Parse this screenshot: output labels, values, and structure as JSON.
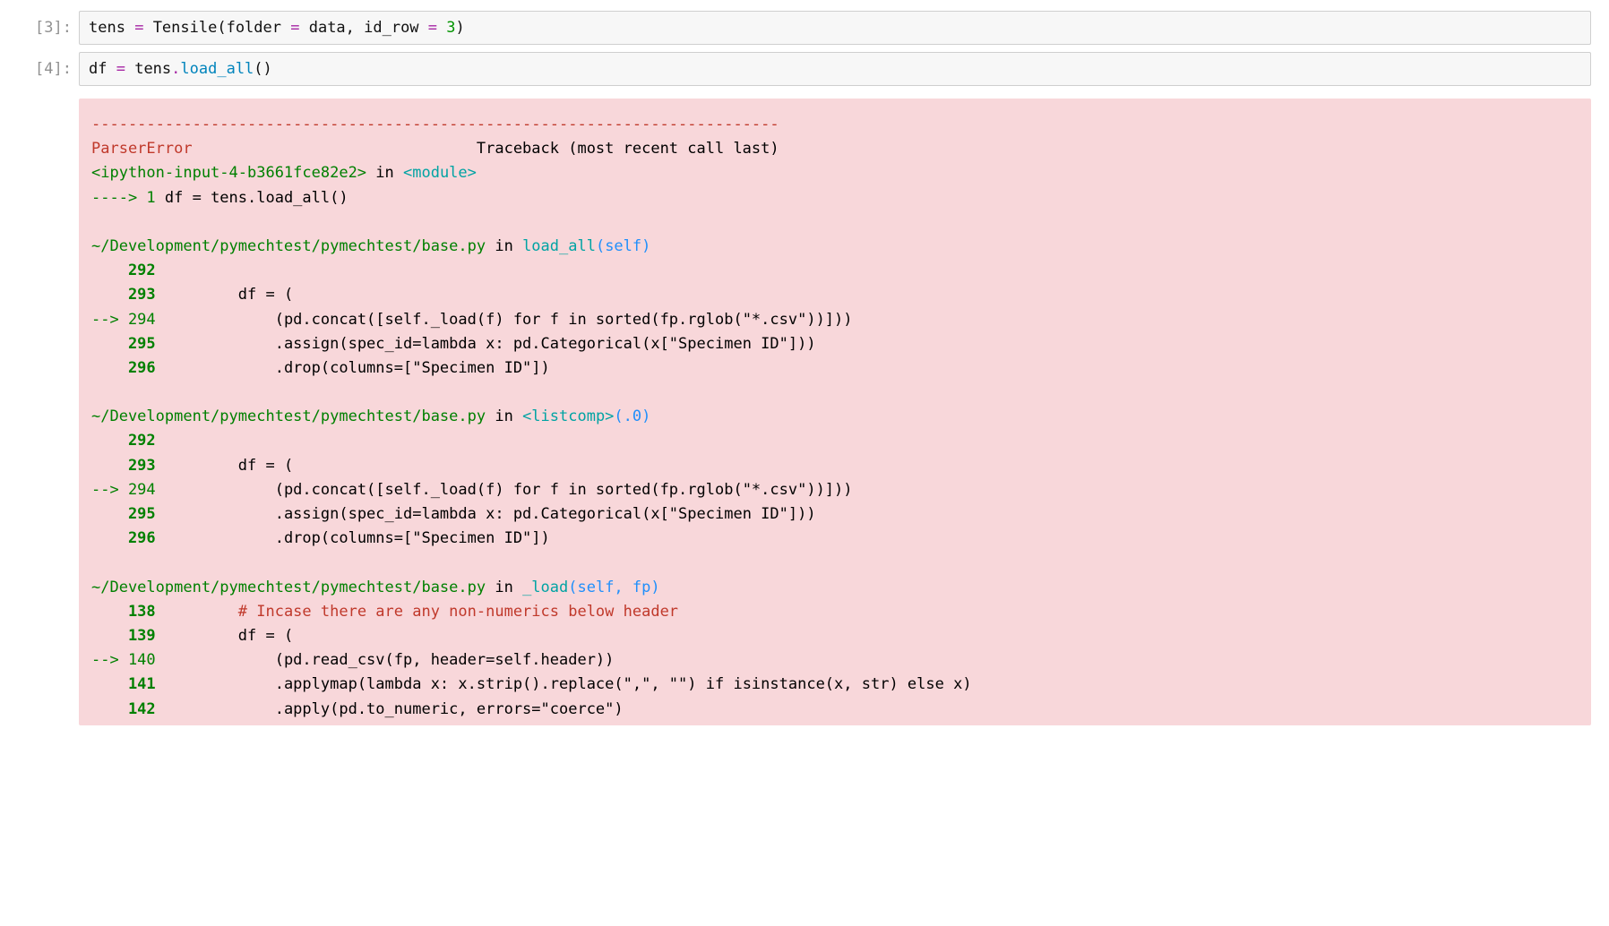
{
  "cells": {
    "c3": {
      "prompt": "[3]:",
      "code": {
        "lhs": "tens ",
        "eq": "=",
        "sp1": " ",
        "call": "Tensile",
        "args": "(folder ",
        "eq2": "=",
        "sp2": " data, id_row ",
        "eq3": "=",
        "sp3": " ",
        "num": "3",
        "close": ")"
      }
    },
    "c4": {
      "prompt": "[4]:",
      "code": {
        "lhs": "df ",
        "eq": "=",
        "sp1": " tens",
        "dot": ".",
        "fn": "load_all",
        "par": "()"
      }
    }
  },
  "traceback": {
    "dashline": "---------------------------------------------------------------------------",
    "error_name": "ParserError",
    "error_header_spacer": "                               ",
    "tb_label": "Traceback (most recent call last)",
    "frame1_loc_pre": "<ipython-input-4-b3661fce82e2>",
    "frame1_in": " in ",
    "frame1_mod": "<module>",
    "frame1_arrow": "----> 1",
    "frame1_line": " df = tens.load_all()",
    "frame2_path": "~/Development/pymechtest/pymechtest/base.py",
    "frame2_in": " in ",
    "frame2_func": "load_all",
    "frame2_args": "(self)",
    "ln292": "    292",
    "ln293_pre": "    293",
    "ln293_code": "         df = (",
    "ln294_arrow": "--> 294",
    "ln294_code": "             (pd.concat([self._load(f) for f in sorted(fp.rglob(\"*.csv\"))]))",
    "ln295_pre": "    295",
    "ln295_code": "             .assign(spec_id=lambda x: pd.Categorical(x[\"Specimen ID\"]))",
    "ln296_pre": "    296",
    "ln296_code": "             .drop(columns=[\"Specimen ID\"])",
    "frame3_path": "~/Development/pymechtest/pymechtest/base.py",
    "frame3_in": " in ",
    "frame3_func": "<listcomp>",
    "frame3_args": "(.0)",
    "ln292b": "    292",
    "ln293b_pre": "    293",
    "ln293b_code": "         df = (",
    "ln294b_arrow": "--> 294",
    "ln294b_code": "             (pd.concat([self._load(f) for f in sorted(fp.rglob(\"*.csv\"))]))",
    "ln295b_pre": "    295",
    "ln295b_code": "             .assign(spec_id=lambda x: pd.Categorical(x[\"Specimen ID\"]))",
    "ln296b_pre": "    296",
    "ln296b_code": "             .drop(columns=[\"Specimen ID\"])",
    "frame4_path": "~/Development/pymechtest/pymechtest/base.py",
    "frame4_in": " in ",
    "frame4_func": "_load",
    "frame4_args": "(self, fp)",
    "ln138_pre": "    138",
    "ln138_code": "         # Incase there are any non-numerics below header",
    "ln139_pre": "    139",
    "ln139_code": "         df = (",
    "ln140_arrow": "--> 140",
    "ln140_code": "             (pd.read_csv(fp, header=self.header))",
    "ln141_pre": "    141",
    "ln141_code": "             .applymap(lambda x: x.strip().replace(\",\", \"\") if isinstance(x, str) else x)",
    "ln142_pre": "    142",
    "ln142_code": "             .apply(pd.to_numeric, errors=\"coerce\")"
  }
}
